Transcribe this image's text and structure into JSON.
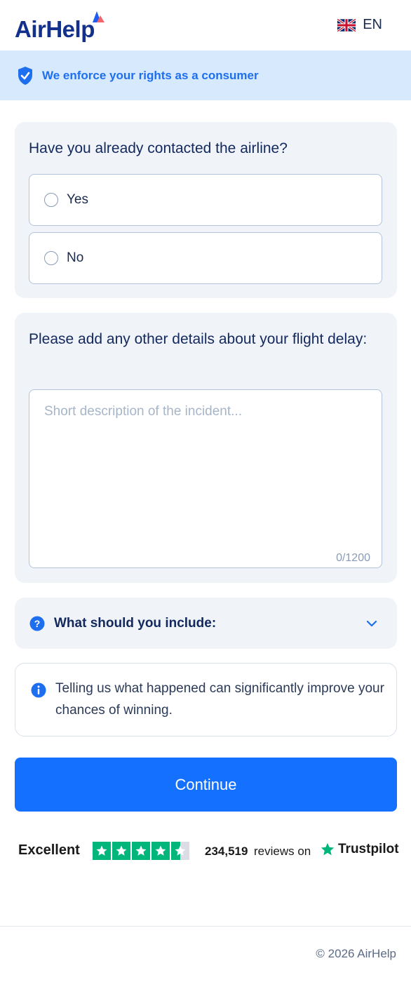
{
  "header": {
    "brand": "AirHelp",
    "language": "EN"
  },
  "banner": {
    "text": "We enforce your rights as a consumer"
  },
  "question1": {
    "title": "Have you already contacted the airline?",
    "options": [
      {
        "label": "Yes"
      },
      {
        "label": "No"
      }
    ]
  },
  "question2": {
    "title": "Please add any other details about your flight delay:",
    "placeholder": "Short description of the incident...",
    "counter": "0/1200"
  },
  "accordion": {
    "title": "What should you include:"
  },
  "info": {
    "text": "Telling us what happened can significantly improve your chances of winning."
  },
  "actions": {
    "continue_label": "Continue"
  },
  "trustpilot": {
    "rating_label": "Excellent",
    "review_count": "234,519",
    "reviews_text": "reviews on",
    "brand": "Trustpilot",
    "stars": 4.5
  },
  "footer": {
    "copyright": "© 2026 AirHelp"
  },
  "colors": {
    "brand_navy": "#13318a",
    "primary_blue": "#1470ff",
    "banner_bg": "#d6e9fd",
    "trustpilot_green": "#00b67a"
  }
}
